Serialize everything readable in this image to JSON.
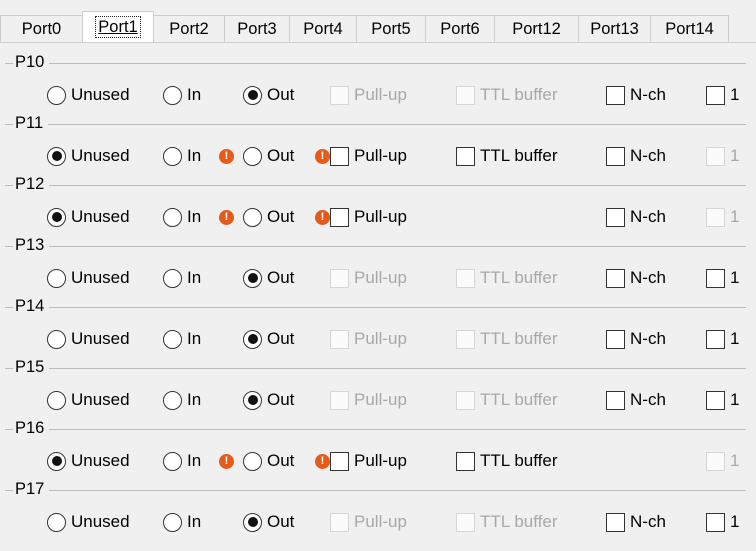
{
  "tabs": [
    "Port0",
    "Port1",
    "Port2",
    "Port3",
    "Port4",
    "Port5",
    "Port6",
    "Port12",
    "Port13",
    "Port14"
  ],
  "active_tab": "Port1",
  "radio_labels": {
    "unused": "Unused",
    "in": "In",
    "out": "Out"
  },
  "option_labels": {
    "pullup": "Pull-up",
    "ttl": "TTL buffer",
    "nch": "N-ch",
    "one": "1"
  },
  "groups": [
    {
      "name": "P10",
      "selected": "out",
      "out_warning": false,
      "pullup_enabled": false,
      "pullup_warning": false,
      "ttl_visible": true,
      "ttl_enabled": false,
      "nch_visible": true,
      "nch_enabled": true,
      "one_enabled": true
    },
    {
      "name": "P11",
      "selected": "unused",
      "out_warning": true,
      "pullup_enabled": true,
      "pullup_warning": true,
      "ttl_visible": true,
      "ttl_enabled": true,
      "nch_visible": true,
      "nch_enabled": true,
      "one_enabled": false
    },
    {
      "name": "P12",
      "selected": "unused",
      "out_warning": true,
      "pullup_enabled": true,
      "pullup_warning": true,
      "ttl_visible": false,
      "ttl_enabled": false,
      "nch_visible": true,
      "nch_enabled": true,
      "one_enabled": false
    },
    {
      "name": "P13",
      "selected": "out",
      "out_warning": false,
      "pullup_enabled": false,
      "pullup_warning": false,
      "ttl_visible": true,
      "ttl_enabled": false,
      "nch_visible": true,
      "nch_enabled": true,
      "one_enabled": true
    },
    {
      "name": "P14",
      "selected": "out",
      "out_warning": false,
      "pullup_enabled": false,
      "pullup_warning": false,
      "ttl_visible": true,
      "ttl_enabled": false,
      "nch_visible": true,
      "nch_enabled": true,
      "one_enabled": true
    },
    {
      "name": "P15",
      "selected": "out",
      "out_warning": false,
      "pullup_enabled": false,
      "pullup_warning": false,
      "ttl_visible": true,
      "ttl_enabled": false,
      "nch_visible": true,
      "nch_enabled": true,
      "one_enabled": true
    },
    {
      "name": "P16",
      "selected": "unused",
      "out_warning": true,
      "pullup_enabled": true,
      "pullup_warning": true,
      "ttl_visible": true,
      "ttl_enabled": true,
      "nch_visible": false,
      "nch_enabled": false,
      "one_enabled": false
    },
    {
      "name": "P17",
      "selected": "out",
      "out_warning": false,
      "pullup_enabled": false,
      "pullup_warning": false,
      "ttl_visible": true,
      "ttl_enabled": false,
      "nch_visible": true,
      "nch_enabled": true,
      "one_enabled": true
    }
  ],
  "colors": {
    "warning": "#e65a1a",
    "disabled_text": "#a8a8a8",
    "background": "#f0f0f0"
  },
  "icons": {
    "warning": "warning-icon"
  }
}
